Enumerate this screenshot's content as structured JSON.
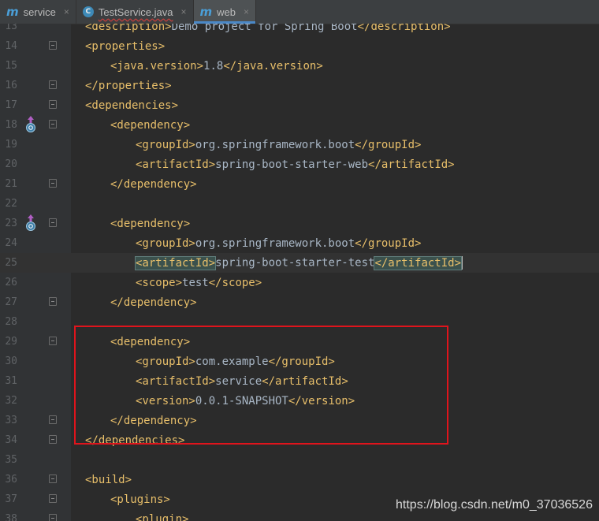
{
  "tabs": [
    {
      "icon": "maven-icon",
      "label": "service",
      "active": false
    },
    {
      "icon": "class-icon",
      "label": "TestService.java",
      "active": false
    },
    {
      "icon": "maven-icon",
      "label": "web",
      "active": true
    }
  ],
  "lines": [
    {
      "n": "13",
      "indent": 0,
      "parts": [
        [
          "tag",
          "<description>"
        ],
        [
          "txt",
          "Demo project for Spring Boot"
        ],
        [
          "tag",
          "</description>"
        ]
      ],
      "fold": false
    },
    {
      "n": "14",
      "indent": 0,
      "parts": [
        [
          "tag",
          "<properties>"
        ]
      ],
      "fold": true
    },
    {
      "n": "15",
      "indent": 1,
      "parts": [
        [
          "tag",
          "<java.version>"
        ],
        [
          "txt",
          "1.8"
        ],
        [
          "tag",
          "</java.version>"
        ]
      ],
      "fold": false
    },
    {
      "n": "16",
      "indent": 0,
      "parts": [
        [
          "tag",
          "</properties>"
        ]
      ],
      "fold": true
    },
    {
      "n": "17",
      "indent": 0,
      "parts": [
        [
          "tag",
          "<dependencies>"
        ]
      ],
      "fold": true
    },
    {
      "n": "18",
      "indent": 1,
      "parts": [
        [
          "tag",
          "<dependency>"
        ]
      ],
      "fold": true,
      "gutter_icon": "override-up-icon"
    },
    {
      "n": "19",
      "indent": 2,
      "parts": [
        [
          "tag",
          "<groupId>"
        ],
        [
          "txt",
          "org.springframework.boot"
        ],
        [
          "tag",
          "</groupId>"
        ]
      ],
      "fold": false
    },
    {
      "n": "20",
      "indent": 2,
      "parts": [
        [
          "tag",
          "<artifactId>"
        ],
        [
          "txt",
          "spring-boot-starter-web"
        ],
        [
          "tag",
          "</artifactId>"
        ]
      ],
      "fold": false
    },
    {
      "n": "21",
      "indent": 1,
      "parts": [
        [
          "tag",
          "</dependency>"
        ]
      ],
      "fold": true
    },
    {
      "n": "22",
      "indent": 0,
      "parts": [],
      "fold": false
    },
    {
      "n": "23",
      "indent": 1,
      "parts": [
        [
          "tag",
          "<dependency>"
        ]
      ],
      "fold": true,
      "gutter_icon": "override-up-icon"
    },
    {
      "n": "24",
      "indent": 2,
      "parts": [
        [
          "tag",
          "<groupId>"
        ],
        [
          "txt",
          "org.springframework.boot"
        ],
        [
          "tag",
          "</groupId>"
        ]
      ],
      "fold": false
    },
    {
      "n": "25",
      "indent": 2,
      "parts": [
        [
          "tagm",
          "<artifactId>"
        ],
        [
          "txt",
          "spring-boot-starter-test"
        ],
        [
          "tagm",
          "</artifactId>"
        ]
      ],
      "fold": false,
      "current": true
    },
    {
      "n": "26",
      "indent": 2,
      "parts": [
        [
          "tag",
          "<scope>"
        ],
        [
          "txt",
          "test"
        ],
        [
          "tag",
          "</scope>"
        ]
      ],
      "fold": false
    },
    {
      "n": "27",
      "indent": 1,
      "parts": [
        [
          "tag",
          "</dependency>"
        ]
      ],
      "fold": true
    },
    {
      "n": "28",
      "indent": 0,
      "parts": [],
      "fold": false
    },
    {
      "n": "29",
      "indent": 1,
      "parts": [
        [
          "tag",
          "<dependency>"
        ]
      ],
      "fold": true
    },
    {
      "n": "30",
      "indent": 2,
      "parts": [
        [
          "tag",
          "<groupId>"
        ],
        [
          "txt",
          "com.example"
        ],
        [
          "tag",
          "</groupId>"
        ]
      ],
      "fold": false
    },
    {
      "n": "31",
      "indent": 2,
      "parts": [
        [
          "tag",
          "<artifactId>"
        ],
        [
          "txt",
          "service"
        ],
        [
          "tag",
          "</artifactId>"
        ]
      ],
      "fold": false
    },
    {
      "n": "32",
      "indent": 2,
      "parts": [
        [
          "tag",
          "<version>"
        ],
        [
          "txt",
          "0.0.1-SNAPSHOT"
        ],
        [
          "tag",
          "</version>"
        ]
      ],
      "fold": false
    },
    {
      "n": "33",
      "indent": 1,
      "parts": [
        [
          "tag",
          "</dependency>"
        ]
      ],
      "fold": true
    },
    {
      "n": "34",
      "indent": 0,
      "parts": [
        [
          "tag",
          "</dependencies>"
        ]
      ],
      "fold": true
    },
    {
      "n": "35",
      "indent": 0,
      "parts": [],
      "fold": false
    },
    {
      "n": "36",
      "indent": 0,
      "parts": [
        [
          "tag",
          "<build>"
        ]
      ],
      "fold": true
    },
    {
      "n": "37",
      "indent": 1,
      "parts": [
        [
          "tag",
          "<plugins>"
        ]
      ],
      "fold": true
    },
    {
      "n": "38",
      "indent": 2,
      "parts": [
        [
          "tag",
          "<plugin>"
        ]
      ],
      "fold": true
    }
  ],
  "watermark": "https://blog.csdn.net/m0_37036526",
  "colors": {
    "tag": "#e8bf6a",
    "text": "#a9b7c6",
    "highlight_box": "#e0141c"
  }
}
